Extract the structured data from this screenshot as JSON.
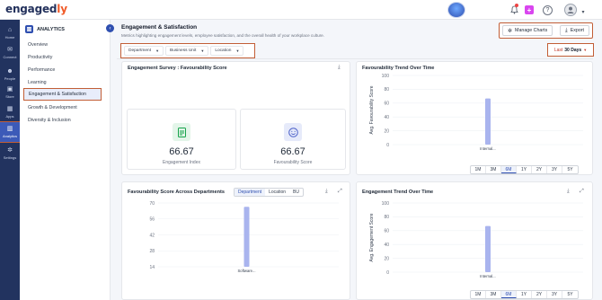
{
  "brand": {
    "logo_main": "engaged",
    "logo_tick": "ly"
  },
  "topbar": {
    "plus_icon": "+",
    "help_icon": "?",
    "avatar_icon": "user-icon",
    "caret": "▾"
  },
  "rail": [
    {
      "label": "Home",
      "icon": "home-icon",
      "glyph": "⌂"
    },
    {
      "label": "Connect",
      "icon": "connect-icon",
      "glyph": "✉"
    },
    {
      "label": "People",
      "icon": "people-icon",
      "glyph": "☻"
    },
    {
      "label": "Store",
      "icon": "store-icon",
      "glyph": "▣"
    },
    {
      "label": "Apps",
      "icon": "apps-icon",
      "glyph": "▦"
    },
    {
      "label": "Analytics",
      "icon": "analytics-icon",
      "glyph": "▥"
    },
    {
      "label": "Settings",
      "icon": "settings-icon",
      "glyph": "✲"
    }
  ],
  "subnav": {
    "title": "ANALYTICS",
    "collapse_glyph": "‹",
    "items": [
      "Overview",
      "Productivity",
      "Performance",
      "Learning",
      "Engagement & Satisfaction",
      "Growth & Development",
      "Diversity & Inclusion"
    ],
    "active_index": 4
  },
  "page": {
    "title": "Engagement & Satisfaction",
    "subtitle": "Metrics highlighting engagement levels, employee satisfaction, and the overall health of your workplace culture."
  },
  "actions": {
    "manage_label": "Manage Charts",
    "export_label": "Export"
  },
  "filters": [
    "Department",
    "Business Unit",
    "Location"
  ],
  "range": {
    "prefix": "Last",
    "value": "30 Days"
  },
  "card_survey": {
    "title": "Engagement Survey : Favourability Score",
    "stats": [
      {
        "value": "66.67",
        "label": "Engagement Index",
        "icon": "document-icon",
        "color": "#16a34a",
        "bg": "#e3f5e9"
      },
      {
        "value": "66.67",
        "label": "Favourability Score",
        "icon": "smile-icon",
        "color": "#4f63c9",
        "bg": "#e6eafa"
      }
    ]
  },
  "card_trend_fav": {
    "title": "Favourability Trend Over Time",
    "tabs": [
      "1M",
      "3M",
      "6M",
      "1Y",
      "2Y",
      "3Y",
      "5Y"
    ],
    "active_tab": "6M"
  },
  "card_dept": {
    "title": "Favourability Score Across Departments",
    "segments": [
      "Department",
      "Location",
      "BU"
    ],
    "active_segment": "Department"
  },
  "card_trend_eng": {
    "title": "Engagement Trend Over Time",
    "tabs": [
      "1M",
      "3M",
      "6M",
      "1Y",
      "2Y",
      "3Y",
      "5Y"
    ],
    "active_tab": "6M"
  },
  "colors": {
    "rail": "#22335f",
    "accent": "#2f4fb0",
    "bar": "#a9b4ee",
    "highlight": "#c25e36"
  },
  "chart_data": [
    {
      "type": "bar",
      "title": "Favourability Trend Over Time",
      "ylabel": "Avg. Favourability Score",
      "categories": [
        "Internal..."
      ],
      "values": [
        66.67
      ],
      "ylim": [
        0,
        100
      ],
      "yticks": [
        0,
        20,
        40,
        60,
        80,
        100
      ],
      "grid": true
    },
    {
      "type": "bar",
      "title": "Favourability Score Across Departments",
      "categories": [
        "Software..."
      ],
      "values": [
        66.67
      ],
      "ylim": [
        14,
        70
      ],
      "yticks": [
        14,
        28,
        42,
        56,
        70
      ],
      "grid": true
    },
    {
      "type": "bar",
      "title": "Engagement Trend Over Time",
      "ylabel": "Avg. Engagement Score",
      "categories": [
        "Internal..."
      ],
      "values": [
        66.67
      ],
      "ylim": [
        0,
        100
      ],
      "yticks": [
        0,
        20,
        40,
        60,
        80,
        100
      ],
      "grid": true
    }
  ]
}
